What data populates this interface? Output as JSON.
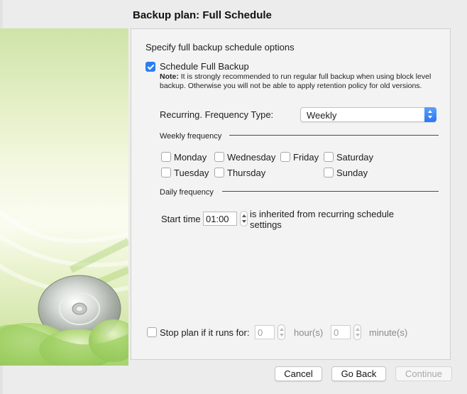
{
  "window": {
    "title": "Backup plan: Full Schedule"
  },
  "content": {
    "heading": "Specify full backup schedule options",
    "schedule_full": {
      "label": "Schedule Full Backup",
      "checked": true
    },
    "note": {
      "prefix": "Note:",
      "text": " It is strongly recommended to run regular full backup when using block level backup. Otherwise you will not be able to apply retention policy for old versions."
    },
    "frequency": {
      "label": "Recurring. Frequency Type:",
      "value": "Weekly"
    },
    "weekly": {
      "label": "Weekly frequency",
      "days": [
        {
          "label": "Monday",
          "checked": false
        },
        {
          "label": "Wednesday",
          "checked": false
        },
        {
          "label": "Friday",
          "checked": false
        },
        {
          "label": "Saturday",
          "checked": false
        },
        {
          "label": "Tuesday",
          "checked": false
        },
        {
          "label": "Thursday",
          "checked": false
        },
        {
          "label": "Sunday",
          "checked": false
        }
      ]
    },
    "daily": {
      "label": "Daily frequency",
      "start_label": "Start time",
      "start_value": "01:00",
      "inherit_text_1": "is inherited from recurring schedule",
      "inherit_text_2": "settings"
    },
    "stop_plan": {
      "label": "Stop plan if it runs for:",
      "checked": false,
      "hours_value": "0",
      "hours_unit": "hour(s)",
      "minutes_value": "0",
      "minutes_unit": "minute(s)"
    }
  },
  "buttons": {
    "cancel": "Cancel",
    "go_back": "Go Back",
    "continue": "Continue"
  },
  "colors": {
    "accent": "#2c7cf6",
    "panel": "#f3f3f3",
    "art_green": "#b8d97e"
  },
  "icons": {
    "art": "cd-disc-icon"
  }
}
